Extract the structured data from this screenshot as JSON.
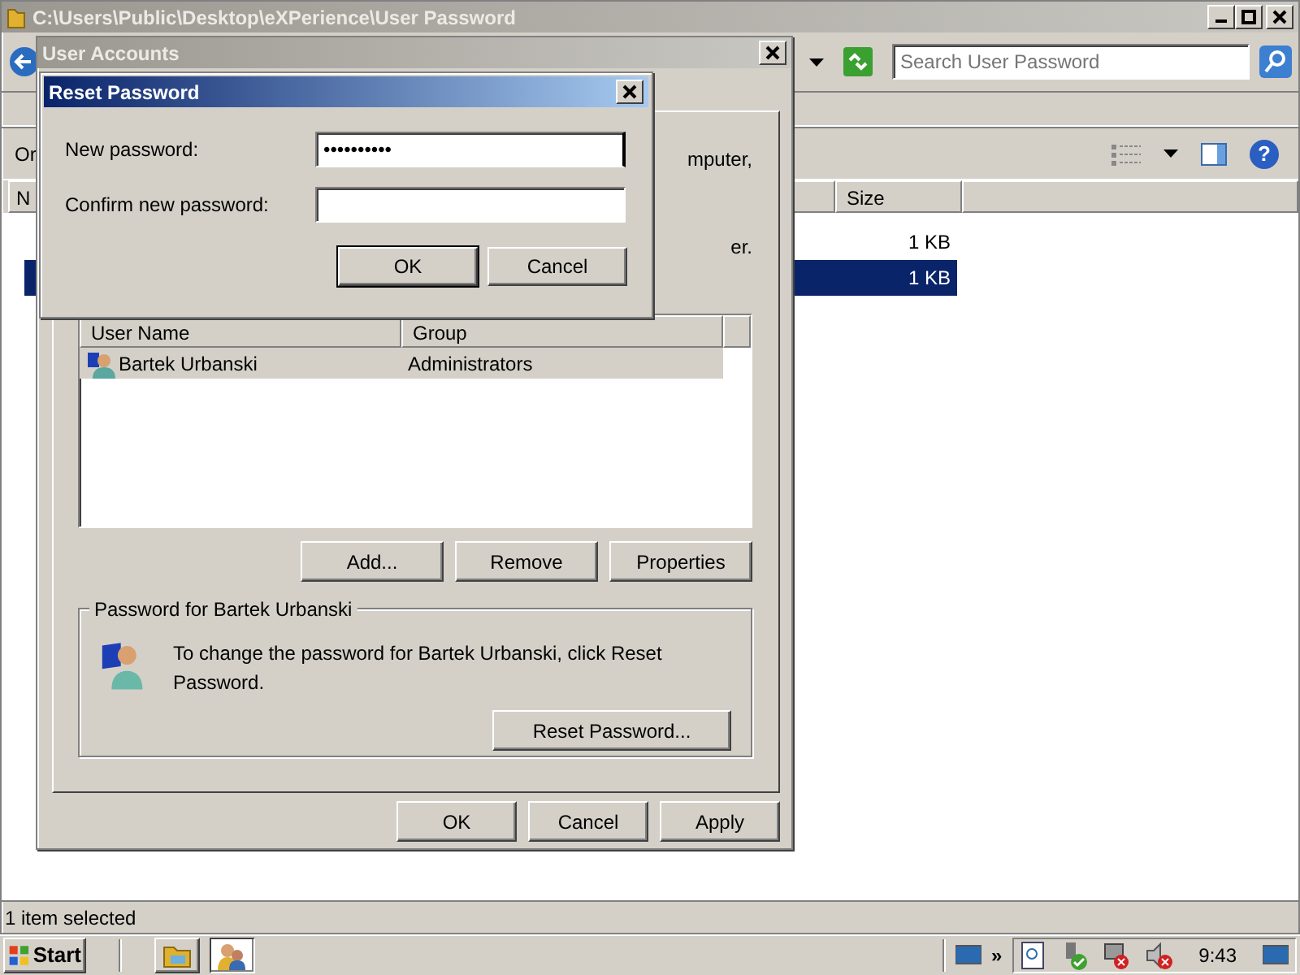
{
  "explorer": {
    "title": "C:\\Users\\Public\\Desktop\\eXPerience\\User Password",
    "search": {
      "placeholder": "Search User Password"
    },
    "toolbar_label": "Or",
    "help_label": "?",
    "columns": [
      "N",
      "Size"
    ],
    "rows": [
      {
        "size": "1 KB",
        "selected": false
      },
      {
        "size": "1 KB",
        "selected": true
      }
    ],
    "status_bar": "1 item selected"
  },
  "user_accounts": {
    "title": "User Accounts",
    "intro_fragments": [
      "mputer,",
      "er."
    ],
    "list_columns": [
      "User Name",
      "Group"
    ],
    "users": [
      {
        "name": "Bartek Urbanski",
        "group": "Administrators",
        "selected": true
      }
    ],
    "buttons": [
      "Add...",
      "Remove",
      "Properties"
    ],
    "password_group": {
      "title": "Password for Bartek Urbanski",
      "text": "To change the password for Bartek Urbanski, click Reset Password.",
      "button": "Reset Password..."
    },
    "footer_buttons": [
      "OK",
      "Cancel",
      "Apply"
    ]
  },
  "reset_dialog": {
    "title": "Reset Password",
    "fields": [
      {
        "label": "New password:",
        "value": "••••••••••",
        "focused": true
      },
      {
        "label": "Confirm new password:",
        "focused": false
      }
    ],
    "buttons": [
      {
        "label": "OK",
        "default": true
      },
      {
        "label": "Cancel",
        "default": false
      }
    ]
  },
  "taskbar": {
    "start": "Start",
    "tasks": [
      {
        "kind": "explorer",
        "selected": false
      },
      {
        "kind": "users",
        "selected": true
      }
    ],
    "chevron": "»",
    "clock": "9:43"
  }
}
